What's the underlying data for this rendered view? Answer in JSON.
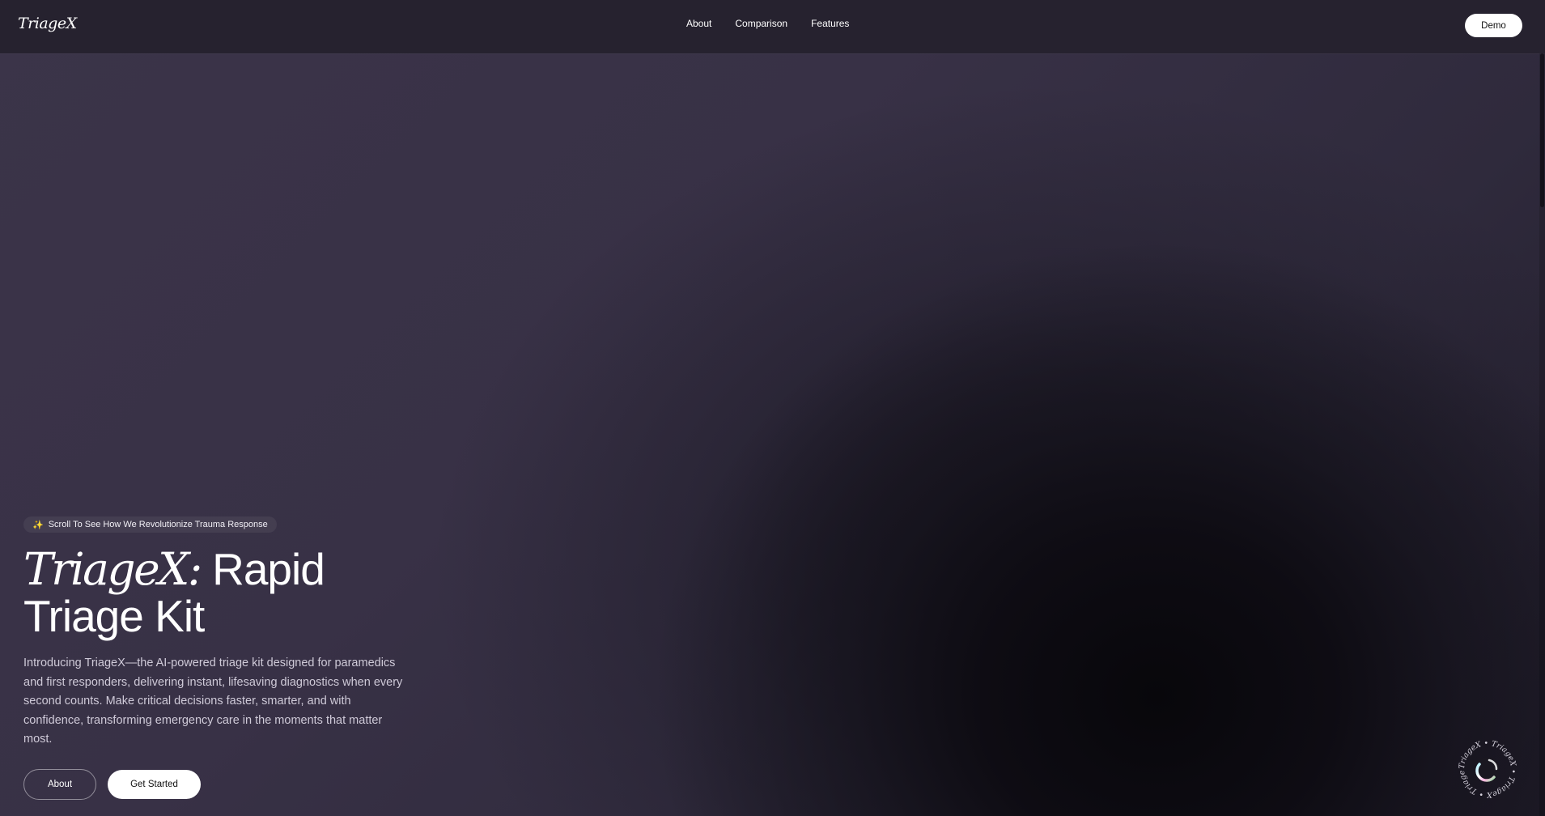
{
  "header": {
    "logo": "TriageX",
    "nav": [
      {
        "label": "About"
      },
      {
        "label": "Comparison"
      },
      {
        "label": "Features"
      }
    ],
    "demo_label": "Demo"
  },
  "hero": {
    "pill_text": "Scroll To See How We Revolutionize Trauma Response",
    "pill_icon": "sparkles-icon",
    "title_brand": "TriageX:",
    "title_line1_rest": "Rapid",
    "title_line2": "Triage Kit",
    "description": "Introducing TriageX—the AI-powered triage kit designed for paramedics and first responders, delivering instant, lifesaving diagnostics when every second counts. Make critical decisions faster, smarter, and with confidence, transforming emergency care in the moments that matter most.",
    "about_label": "About",
    "get_started_label": "Get Started"
  },
  "badge": {
    "ring_text": "TriageX • TriageX • TriageX • TriageX •"
  },
  "colors": {
    "background": "#3a3348",
    "header": "#26222f",
    "accent": "#ffffff",
    "text_muted": "#cfcad8"
  }
}
